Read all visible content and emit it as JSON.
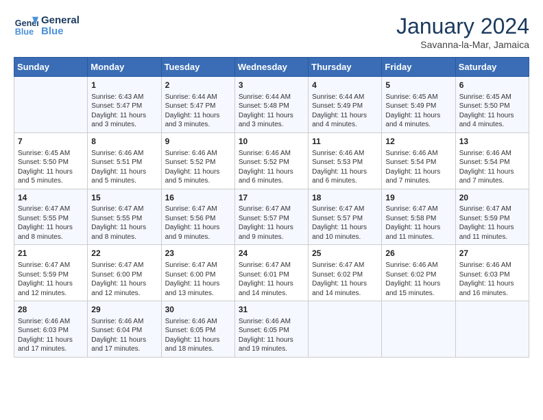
{
  "header": {
    "logo_general": "General",
    "logo_blue": "Blue",
    "month_title": "January 2024",
    "subtitle": "Savanna-la-Mar, Jamaica"
  },
  "days_of_week": [
    "Sunday",
    "Monday",
    "Tuesday",
    "Wednesday",
    "Thursday",
    "Friday",
    "Saturday"
  ],
  "weeks": [
    [
      {
        "day": "",
        "sunrise": "",
        "sunset": "",
        "daylight": ""
      },
      {
        "day": "1",
        "sunrise": "Sunrise: 6:43 AM",
        "sunset": "Sunset: 5:47 PM",
        "daylight": "Daylight: 11 hours and 3 minutes."
      },
      {
        "day": "2",
        "sunrise": "Sunrise: 6:44 AM",
        "sunset": "Sunset: 5:47 PM",
        "daylight": "Daylight: 11 hours and 3 minutes."
      },
      {
        "day": "3",
        "sunrise": "Sunrise: 6:44 AM",
        "sunset": "Sunset: 5:48 PM",
        "daylight": "Daylight: 11 hours and 3 minutes."
      },
      {
        "day": "4",
        "sunrise": "Sunrise: 6:44 AM",
        "sunset": "Sunset: 5:49 PM",
        "daylight": "Daylight: 11 hours and 4 minutes."
      },
      {
        "day": "5",
        "sunrise": "Sunrise: 6:45 AM",
        "sunset": "Sunset: 5:49 PM",
        "daylight": "Daylight: 11 hours and 4 minutes."
      },
      {
        "day": "6",
        "sunrise": "Sunrise: 6:45 AM",
        "sunset": "Sunset: 5:50 PM",
        "daylight": "Daylight: 11 hours and 4 minutes."
      }
    ],
    [
      {
        "day": "7",
        "sunrise": "Sunrise: 6:45 AM",
        "sunset": "Sunset: 5:50 PM",
        "daylight": "Daylight: 11 hours and 5 minutes."
      },
      {
        "day": "8",
        "sunrise": "Sunrise: 6:46 AM",
        "sunset": "Sunset: 5:51 PM",
        "daylight": "Daylight: 11 hours and 5 minutes."
      },
      {
        "day": "9",
        "sunrise": "Sunrise: 6:46 AM",
        "sunset": "Sunset: 5:52 PM",
        "daylight": "Daylight: 11 hours and 5 minutes."
      },
      {
        "day": "10",
        "sunrise": "Sunrise: 6:46 AM",
        "sunset": "Sunset: 5:52 PM",
        "daylight": "Daylight: 11 hours and 6 minutes."
      },
      {
        "day": "11",
        "sunrise": "Sunrise: 6:46 AM",
        "sunset": "Sunset: 5:53 PM",
        "daylight": "Daylight: 11 hours and 6 minutes."
      },
      {
        "day": "12",
        "sunrise": "Sunrise: 6:46 AM",
        "sunset": "Sunset: 5:54 PM",
        "daylight": "Daylight: 11 hours and 7 minutes."
      },
      {
        "day": "13",
        "sunrise": "Sunrise: 6:46 AM",
        "sunset": "Sunset: 5:54 PM",
        "daylight": "Daylight: 11 hours and 7 minutes."
      }
    ],
    [
      {
        "day": "14",
        "sunrise": "Sunrise: 6:47 AM",
        "sunset": "Sunset: 5:55 PM",
        "daylight": "Daylight: 11 hours and 8 minutes."
      },
      {
        "day": "15",
        "sunrise": "Sunrise: 6:47 AM",
        "sunset": "Sunset: 5:55 PM",
        "daylight": "Daylight: 11 hours and 8 minutes."
      },
      {
        "day": "16",
        "sunrise": "Sunrise: 6:47 AM",
        "sunset": "Sunset: 5:56 PM",
        "daylight": "Daylight: 11 hours and 9 minutes."
      },
      {
        "day": "17",
        "sunrise": "Sunrise: 6:47 AM",
        "sunset": "Sunset: 5:57 PM",
        "daylight": "Daylight: 11 hours and 9 minutes."
      },
      {
        "day": "18",
        "sunrise": "Sunrise: 6:47 AM",
        "sunset": "Sunset: 5:57 PM",
        "daylight": "Daylight: 11 hours and 10 minutes."
      },
      {
        "day": "19",
        "sunrise": "Sunrise: 6:47 AM",
        "sunset": "Sunset: 5:58 PM",
        "daylight": "Daylight: 11 hours and 11 minutes."
      },
      {
        "day": "20",
        "sunrise": "Sunrise: 6:47 AM",
        "sunset": "Sunset: 5:59 PM",
        "daylight": "Daylight: 11 hours and 11 minutes."
      }
    ],
    [
      {
        "day": "21",
        "sunrise": "Sunrise: 6:47 AM",
        "sunset": "Sunset: 5:59 PM",
        "daylight": "Daylight: 11 hours and 12 minutes."
      },
      {
        "day": "22",
        "sunrise": "Sunrise: 6:47 AM",
        "sunset": "Sunset: 6:00 PM",
        "daylight": "Daylight: 11 hours and 12 minutes."
      },
      {
        "day": "23",
        "sunrise": "Sunrise: 6:47 AM",
        "sunset": "Sunset: 6:00 PM",
        "daylight": "Daylight: 11 hours and 13 minutes."
      },
      {
        "day": "24",
        "sunrise": "Sunrise: 6:47 AM",
        "sunset": "Sunset: 6:01 PM",
        "daylight": "Daylight: 11 hours and 14 minutes."
      },
      {
        "day": "25",
        "sunrise": "Sunrise: 6:47 AM",
        "sunset": "Sunset: 6:02 PM",
        "daylight": "Daylight: 11 hours and 14 minutes."
      },
      {
        "day": "26",
        "sunrise": "Sunrise: 6:46 AM",
        "sunset": "Sunset: 6:02 PM",
        "daylight": "Daylight: 11 hours and 15 minutes."
      },
      {
        "day": "27",
        "sunrise": "Sunrise: 6:46 AM",
        "sunset": "Sunset: 6:03 PM",
        "daylight": "Daylight: 11 hours and 16 minutes."
      }
    ],
    [
      {
        "day": "28",
        "sunrise": "Sunrise: 6:46 AM",
        "sunset": "Sunset: 6:03 PM",
        "daylight": "Daylight: 11 hours and 17 minutes."
      },
      {
        "day": "29",
        "sunrise": "Sunrise: 6:46 AM",
        "sunset": "Sunset: 6:04 PM",
        "daylight": "Daylight: 11 hours and 17 minutes."
      },
      {
        "day": "30",
        "sunrise": "Sunrise: 6:46 AM",
        "sunset": "Sunset: 6:05 PM",
        "daylight": "Daylight: 11 hours and 18 minutes."
      },
      {
        "day": "31",
        "sunrise": "Sunrise: 6:46 AM",
        "sunset": "Sunset: 6:05 PM",
        "daylight": "Daylight: 11 hours and 19 minutes."
      },
      {
        "day": "",
        "sunrise": "",
        "sunset": "",
        "daylight": ""
      },
      {
        "day": "",
        "sunrise": "",
        "sunset": "",
        "daylight": ""
      },
      {
        "day": "",
        "sunrise": "",
        "sunset": "",
        "daylight": ""
      }
    ]
  ]
}
